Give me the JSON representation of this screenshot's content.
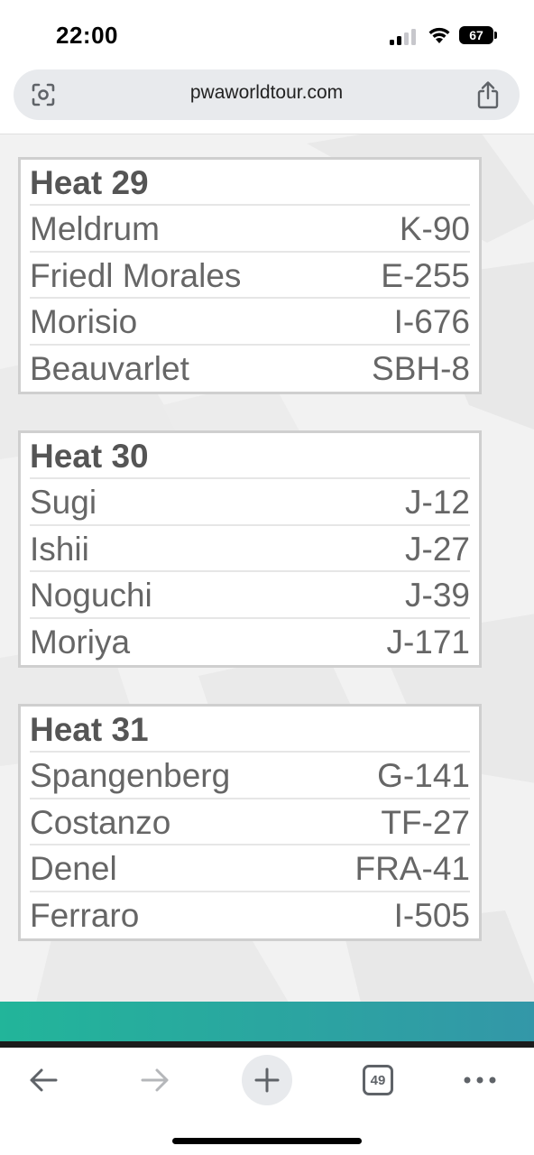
{
  "status": {
    "time": "22:00",
    "battery": "67"
  },
  "browser": {
    "url": "pwaworldtour.com",
    "tab_count": "49"
  },
  "heats": [
    {
      "title": "Heat 29",
      "riders": [
        {
          "name": "Meldrum",
          "sail": "K-90"
        },
        {
          "name": "Friedl Morales",
          "sail": "E-255"
        },
        {
          "name": "Morisio",
          "sail": "I-676"
        },
        {
          "name": "Beauvarlet",
          "sail": "SBH-8"
        }
      ]
    },
    {
      "title": "Heat 30",
      "riders": [
        {
          "name": "Sugi",
          "sail": "J-12"
        },
        {
          "name": "Ishii",
          "sail": "J-27"
        },
        {
          "name": "Noguchi",
          "sail": "J-39"
        },
        {
          "name": "Moriya",
          "sail": "J-171"
        }
      ]
    },
    {
      "title": "Heat 31",
      "riders": [
        {
          "name": "Spangenberg",
          "sail": "G-141"
        },
        {
          "name": "Costanzo",
          "sail": "TF-27"
        },
        {
          "name": "Denel",
          "sail": "FRA-41"
        },
        {
          "name": "Ferraro",
          "sail": "I-505"
        }
      ]
    }
  ],
  "toolbar": {
    "icons": [
      "back-icon",
      "forward-icon",
      "plus-icon",
      "tabs-icon",
      "more-icon"
    ]
  },
  "colors": {
    "banner_start": "#22b59a",
    "banner_end": "#3397a8",
    "url_bar_bg": "#e8eaed"
  }
}
